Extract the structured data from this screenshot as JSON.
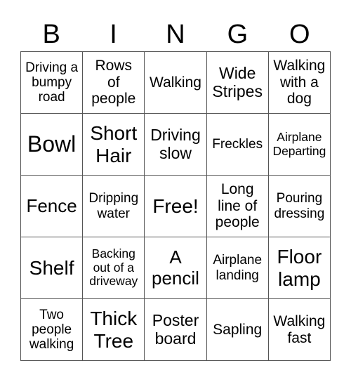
{
  "header": {
    "letters": [
      "B",
      "I",
      "N",
      "G",
      "O"
    ]
  },
  "grid": {
    "rows": [
      [
        "Driving a bumpy road",
        "Rows of people",
        "Walking",
        "Wide Stripes",
        "Walking with a dog"
      ],
      [
        "Bowl",
        "Short Hair",
        "Driving slow",
        "Freckles",
        "Airplane Departing"
      ],
      [
        "Fence",
        "Dripping water",
        "Free!",
        "Long line of people",
        "Pouring dressing"
      ],
      [
        "Shelf",
        "Backing out of a driveway",
        "A pencil",
        "Airplane landing",
        "Floor lamp"
      ],
      [
        "Two people walking",
        "Thick Tree",
        "Poster board",
        "Sapling",
        "Walking fast"
      ]
    ]
  },
  "colors": {
    "grid_line": "#555555",
    "text": "#000000",
    "background": "#ffffff"
  }
}
